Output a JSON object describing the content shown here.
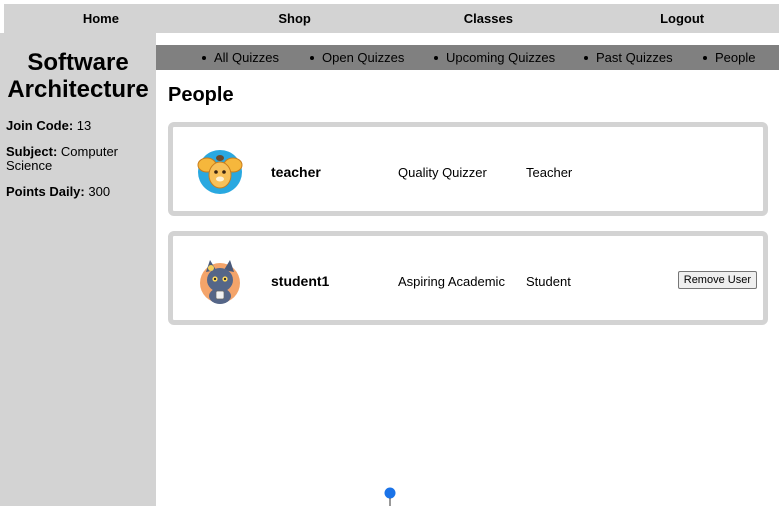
{
  "topnav": {
    "home": "Home",
    "shop": "Shop",
    "classes": "Classes",
    "logout": "Logout"
  },
  "sidebar": {
    "class_title_line1": "Software",
    "class_title_line2": "Architecture",
    "join_code_label": "Join Code:",
    "join_code_value": "13",
    "subject_label": "Subject:",
    "subject_value": "Computer Science",
    "points_label": "Points Daily:",
    "points_value": "300"
  },
  "subnav": {
    "items": [
      "All Quizzes",
      "Open Quizzes",
      "Upcoming Quizzes",
      "Past Quizzes",
      "People"
    ]
  },
  "main": {
    "title": "People",
    "people": [
      {
        "username": "teacher",
        "rank": "Quality Quizzer",
        "role": "Teacher",
        "avatar_icon": "fox-avatar-icon"
      },
      {
        "username": "student1",
        "rank": "Aspiring Academic",
        "role": "Student",
        "avatar_icon": "cat-avatar-icon",
        "action": "Remove User"
      }
    ]
  },
  "colors": {
    "nav_bg": "#d3d3d3",
    "subnav_bg": "#808080",
    "card_border": "#d3d3d3",
    "pin_color": "#1a73e8"
  }
}
